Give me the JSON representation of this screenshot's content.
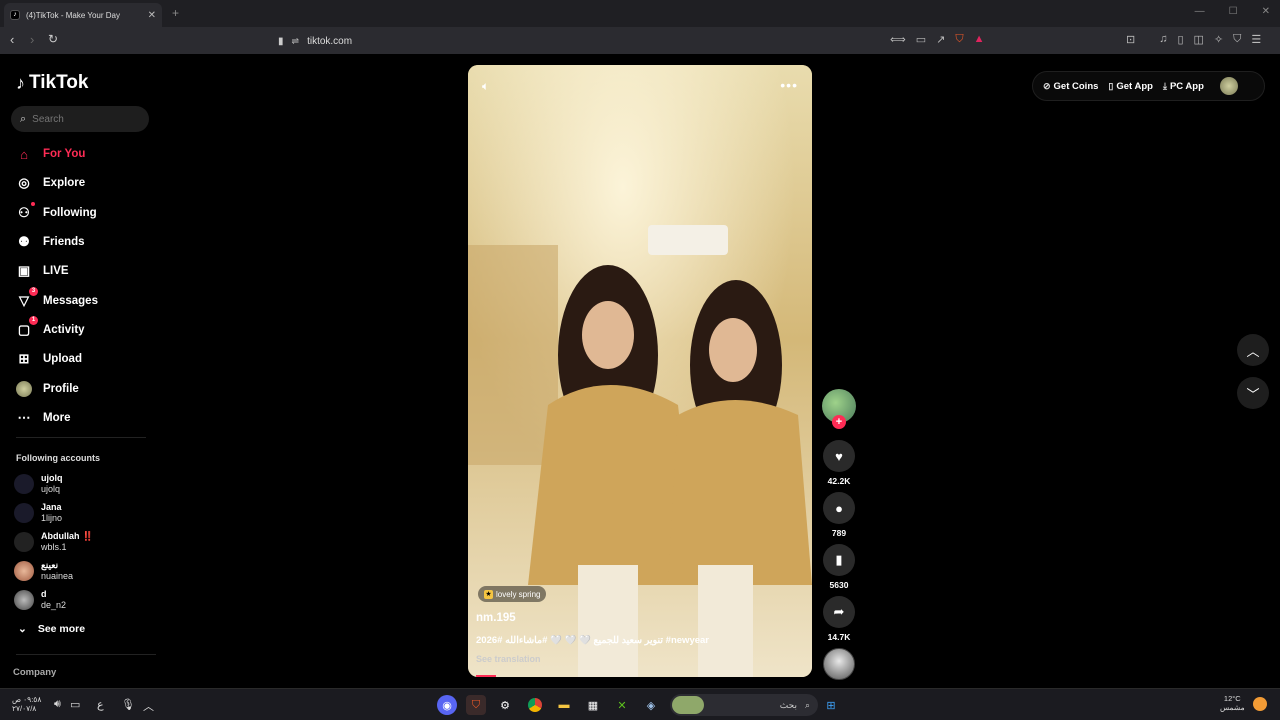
{
  "browser": {
    "tab_title": "(4)TikTok - Make Your Day",
    "tab_favicon": "tiktok-icon",
    "url": "tiktok.com",
    "new_tab": "+"
  },
  "sidebar": {
    "logo": "TikTok",
    "search_placeholder": "Search",
    "nav": [
      {
        "label": "For You",
        "icon": "home-icon",
        "active": true
      },
      {
        "label": "Explore",
        "icon": "compass-icon"
      },
      {
        "label": "Following",
        "icon": "following-icon"
      },
      {
        "label": "Friends",
        "icon": "friends-icon"
      },
      {
        "label": "LIVE",
        "icon": "live-icon"
      },
      {
        "label": "Messages",
        "icon": "messages-icon",
        "badge": "3"
      },
      {
        "label": "Activity",
        "icon": "activity-icon",
        "badge": "1"
      },
      {
        "label": "Upload",
        "icon": "upload-icon"
      },
      {
        "label": "Profile",
        "icon": "profile-icon"
      },
      {
        "label": "More",
        "icon": "more-icon"
      }
    ],
    "following_title": "Following accounts",
    "accounts": [
      {
        "name": "ujolq",
        "handle": "ujolq"
      },
      {
        "name": "Jana",
        "handle": "1lijno"
      },
      {
        "name": "Abdullah ‼️",
        "handle": "wbls.1"
      },
      {
        "name": "نعينع",
        "handle": "nuainea"
      },
      {
        "name": "d",
        "handle": "de_n2"
      }
    ],
    "see_more": "See more",
    "company": "Company"
  },
  "video": {
    "tag": "lovely spring",
    "username": "nm.195",
    "caption": "تنوير سعيد للجميع 🤍 🤍 🤍 #ماشاءالله #2026 #newyear",
    "see_translation": "See translation"
  },
  "actions": {
    "likes": "42.2K",
    "comments": "789",
    "saves": "5630",
    "shares": "14.7K"
  },
  "topbar": {
    "get_coins": "Get Coins",
    "get_app": "Get App",
    "pc_app": "PC App"
  },
  "taskbar": {
    "time": "٠٩:٥٨ ص",
    "date": "٢٧/٠٧/٨",
    "search": "بحث",
    "weather_temp": "12°C",
    "weather_desc": "مشمس",
    "lang": "ع"
  },
  "colors": {
    "accent": "#fe2c55",
    "background": "#000000"
  }
}
